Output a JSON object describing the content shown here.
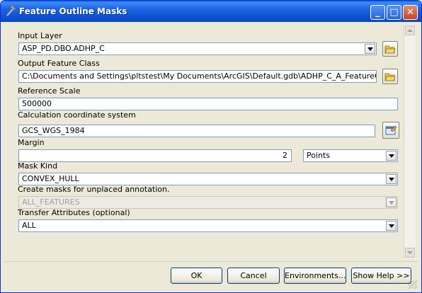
{
  "window": {
    "title": "Feature Outline Masks",
    "icon": "tool-hammer-icon",
    "controls": {
      "minimize": "_",
      "maximize": "□",
      "close": "✕"
    }
  },
  "form": {
    "input_layer": {
      "label": "Input Layer",
      "value": "ASP_PD.DBO.ADHP_C"
    },
    "output_feature_class": {
      "label": "Output Feature Class",
      "value": "C:\\Documents and Settings\\pltstest\\My Documents\\ArcGIS\\Default.gdb\\ADHP_C_A_FeatureOutlineMa"
    },
    "reference_scale": {
      "label": "Reference Scale",
      "value": "500000"
    },
    "coordinate_system": {
      "label": "Calculation coordinate system",
      "value": "GCS_WGS_1984"
    },
    "margin": {
      "label": "Margin",
      "value": "2",
      "unit": "Points"
    },
    "mask_kind": {
      "label": "Mask Kind",
      "value": "CONVEX_HULL"
    },
    "unplaced": {
      "label": "Create masks for unplaced annotation.",
      "value": "ALL_FEATURES"
    },
    "transfer_attributes": {
      "label": "Transfer Attributes (optional)",
      "value": "ALL"
    }
  },
  "buttons": {
    "ok": "OK",
    "cancel": "Cancel",
    "environments": "Environments...",
    "show_help": "Show Help >>"
  },
  "colors": {
    "title_bar": "#1d63e3",
    "dialog_bg": "#ece9d8"
  }
}
